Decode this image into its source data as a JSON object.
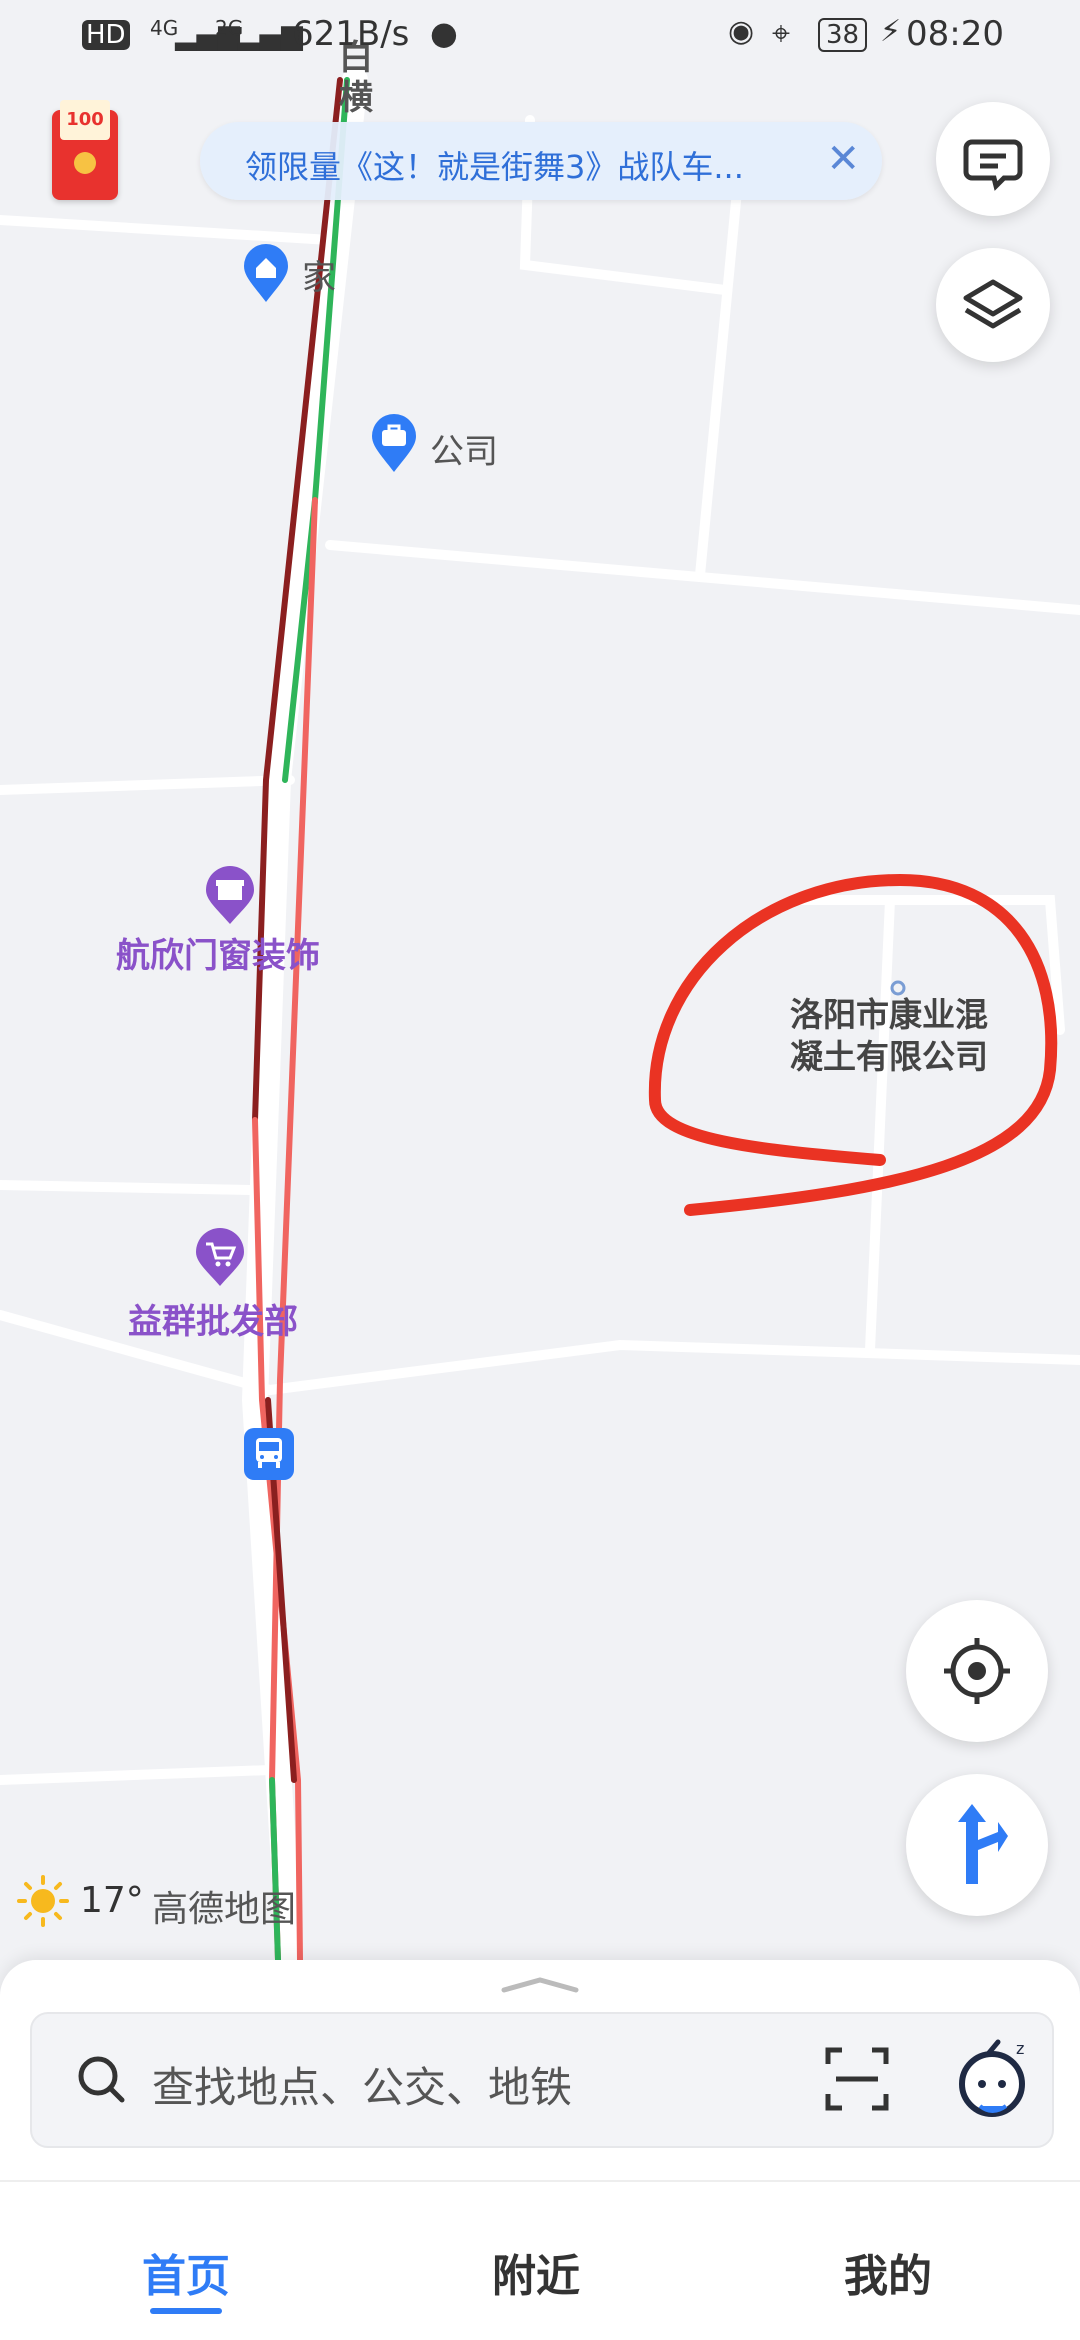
{
  "status_bar": {
    "network_label": "HD",
    "signal_1": "4G",
    "signal_2": "2G",
    "speed": "621B/s",
    "battery": "38",
    "time": "08:20"
  },
  "map": {
    "road_label": "白横",
    "pois": {
      "home": "家",
      "company": "公司",
      "decor_shop": "航欣门窗装饰",
      "target_company": "洛阳市康业混凝土有限公司",
      "target_company_line1": "洛阳市康业混",
      "target_company_line2": "凝土有限公司",
      "wholesale": "益群批发部"
    },
    "highlight_color": "#ea3323"
  },
  "banner": {
    "text": "领限量《这！就是街舞3》战队车...",
    "red_packet_text": "100"
  },
  "weather": {
    "temperature": "17°",
    "brand": "高德地图"
  },
  "search": {
    "placeholder": "查找地点、公交、地铁"
  },
  "tabs": {
    "home": "首页",
    "nearby": "附近",
    "mine": "我的"
  },
  "colors": {
    "accent": "#2f7cf6",
    "poi_purple": "#8a52c9",
    "poi_blue": "#2f7cf6"
  }
}
